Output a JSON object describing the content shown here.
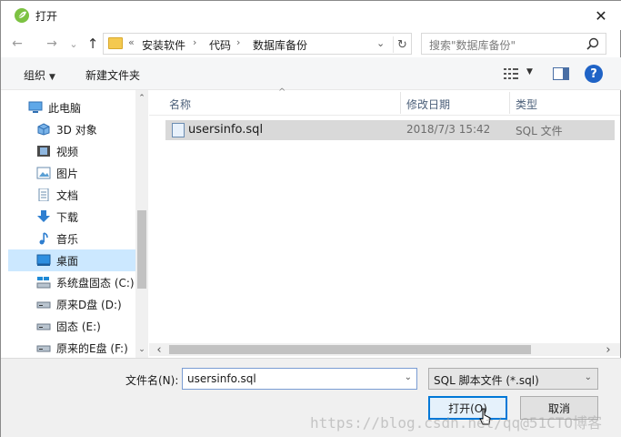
{
  "window": {
    "title": "打开",
    "close_glyph": "✕"
  },
  "nav": {
    "back_glyph": "←",
    "forward_glyph": "→",
    "recent_glyph": "⌄",
    "up_glyph": "↑",
    "address": {
      "prefix": "«",
      "crumbs": [
        "安装软件",
        "代码",
        "数据库备份"
      ],
      "separator": "›",
      "dropdown_glyph": "⌄",
      "refresh_glyph": "↻"
    },
    "search_placeholder": "搜索\"数据库备份\""
  },
  "toolbar": {
    "organize_label": "组织",
    "organize_caret": "▼",
    "new_folder_label": "新建文件夹",
    "view_caret": "▼",
    "help_glyph": "?"
  },
  "sidebar": {
    "items": [
      {
        "label": "此电脑",
        "icon": "computer-icon"
      },
      {
        "label": "3D 对象",
        "icon": "cube-icon"
      },
      {
        "label": "视频",
        "icon": "video-icon"
      },
      {
        "label": "图片",
        "icon": "picture-icon"
      },
      {
        "label": "文档",
        "icon": "document-icon"
      },
      {
        "label": "下载",
        "icon": "download-icon"
      },
      {
        "label": "音乐",
        "icon": "music-icon"
      },
      {
        "label": "桌面",
        "icon": "desktop-icon",
        "selected": true
      },
      {
        "label": "系统盘固态 (C:)",
        "icon": "system-drive-icon"
      },
      {
        "label": "原来D盘 (D:)",
        "icon": "drive-icon"
      },
      {
        "label": "固态 (E:)",
        "icon": "drive-icon"
      },
      {
        "label": "原来的E盘 (F:)",
        "icon": "drive-icon"
      }
    ],
    "scroll_up": "⌃",
    "scroll_down": "⌄"
  },
  "files": {
    "columns": [
      "名称",
      "修改日期",
      "类型"
    ],
    "sort_glyph": "^",
    "rows": [
      {
        "name": "usersinfo.sql",
        "date": "2018/7/3 15:42",
        "type": "SQL 文件"
      }
    ],
    "scroll_left": "‹",
    "scroll_right": "›"
  },
  "bottom": {
    "filename_label": "文件名(N):",
    "filename_value": "usersinfo.sql",
    "filename_drop": "⌄",
    "filetype_value": "SQL 脚本文件 (*.sql)",
    "filetype_drop": "⌄",
    "open_label": "打开(O)",
    "cancel_label": "取消"
  },
  "watermark": "https://blog.csdn.net/qq@51CTO博客",
  "colors": {
    "selection": "#cce8ff",
    "accent": "#0078d7",
    "help": "#1f63c6",
    "folder": "#f4c94f"
  }
}
